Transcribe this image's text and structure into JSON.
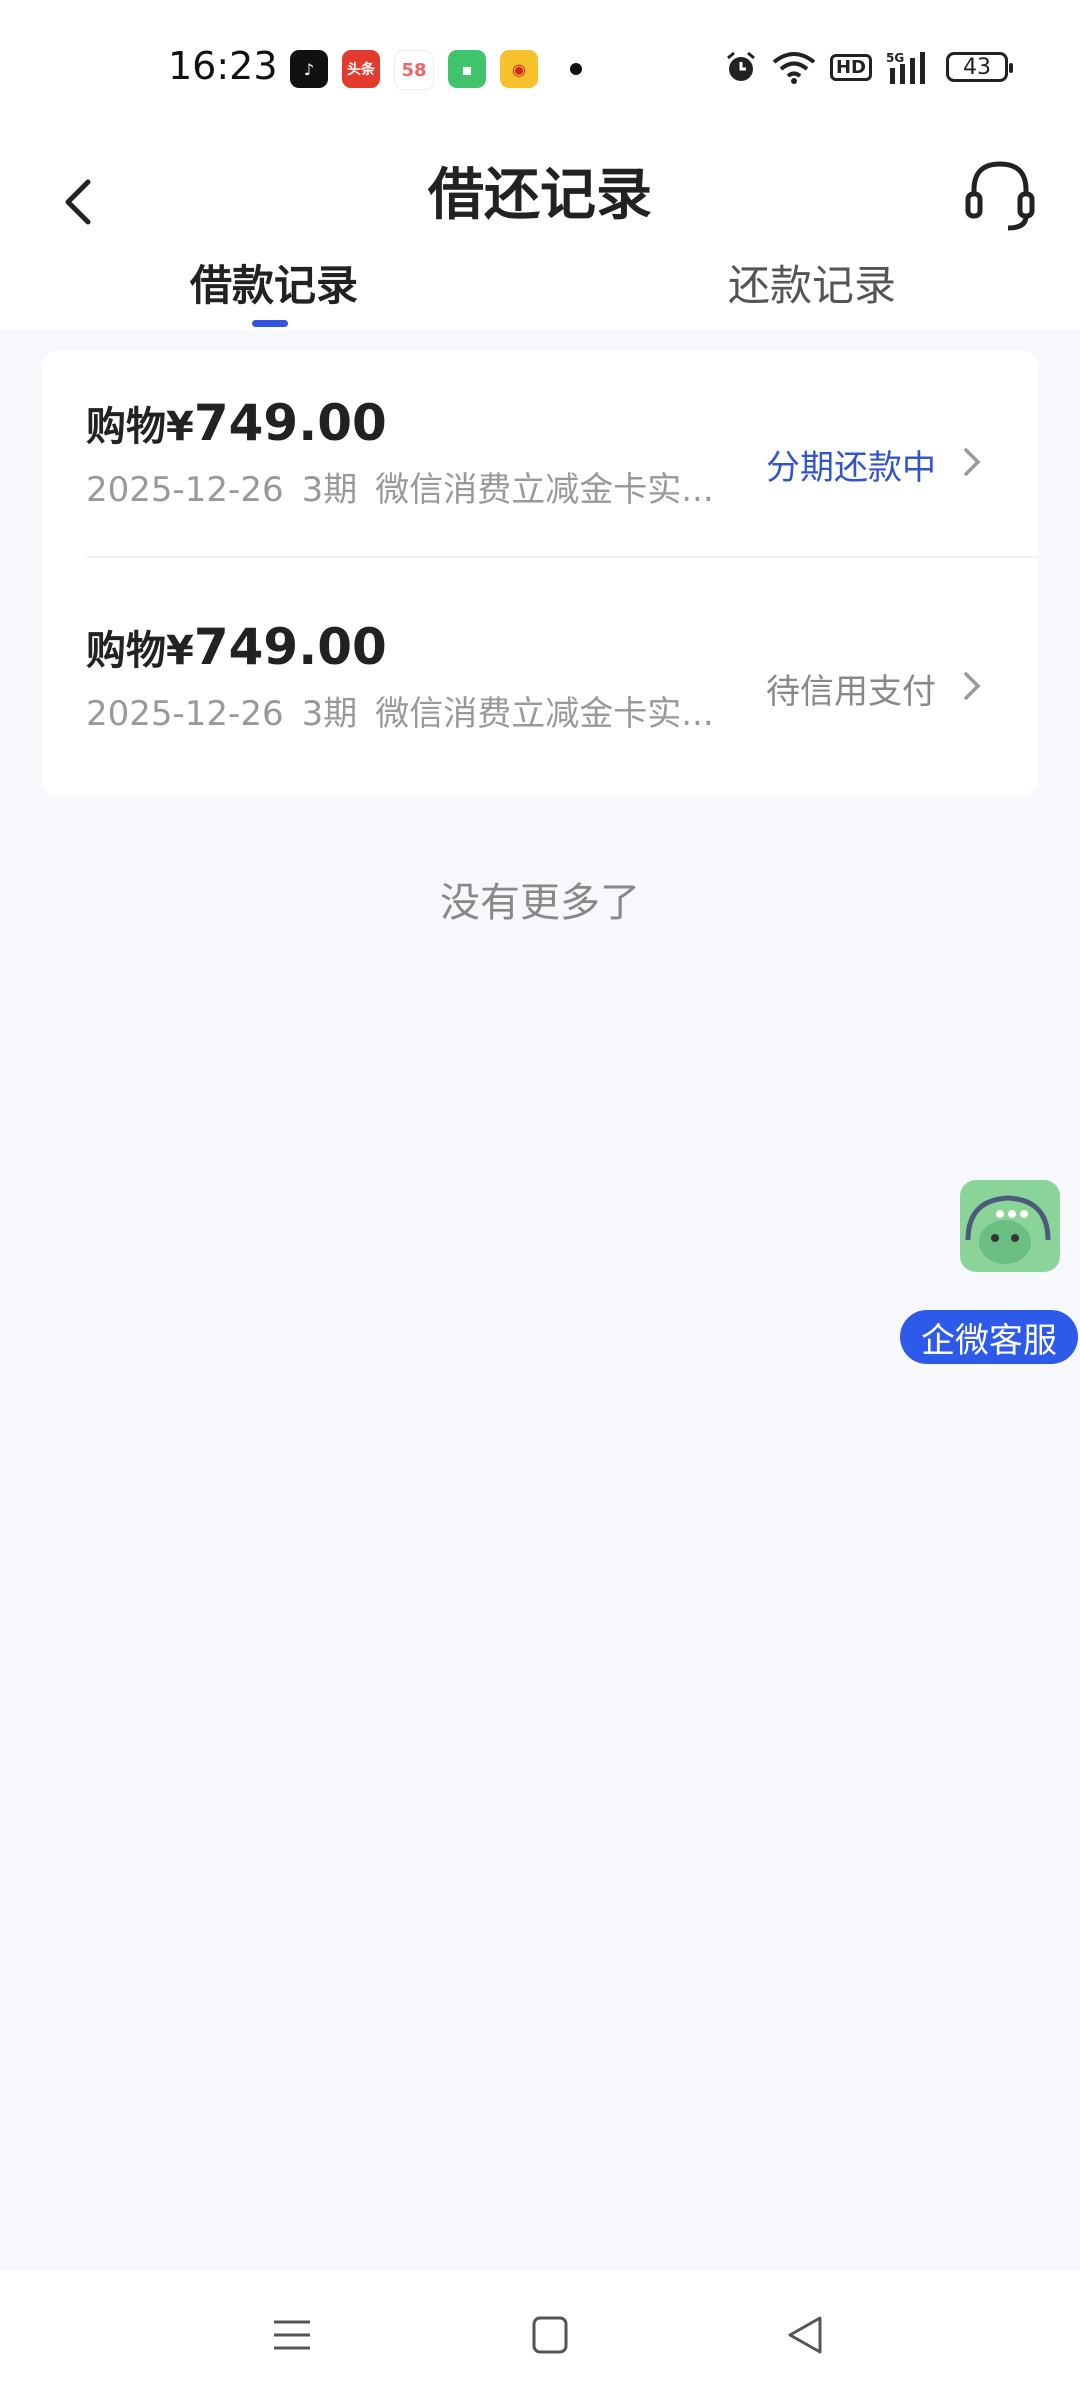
{
  "status_bar": {
    "time": "16:23",
    "apps": [
      "douyin-icon",
      "toutiao-icon",
      "58-icon",
      "messages-icon",
      "weibo-icon"
    ],
    "app_labels": {
      "toutiao": "头条",
      "fiftyeight": "58"
    },
    "battery": "43",
    "hd_label": "HD"
  },
  "header": {
    "title": "借还记录",
    "tabs": [
      {
        "label": "借款记录",
        "active": true
      },
      {
        "label": "还款记录",
        "active": false
      }
    ]
  },
  "records": [
    {
      "prefix": "购物",
      "currency": "¥",
      "amount": "749.00",
      "date": "2025-12-26",
      "term": "3期",
      "desc": "微信消费立减金卡实...",
      "status": "分期还款中"
    },
    {
      "prefix": "购物",
      "currency": "¥",
      "amount": "749.00",
      "date": "2025-12-26",
      "term": "3期",
      "desc": "微信消费立减金卡实...",
      "status": "待信用支付"
    }
  ],
  "no_more_text": "没有更多了",
  "float_support": {
    "label": "企微客服"
  },
  "colors": {
    "accent": "#3355e0",
    "status_active": "#3355cc",
    "background": "#f7f8fc"
  }
}
